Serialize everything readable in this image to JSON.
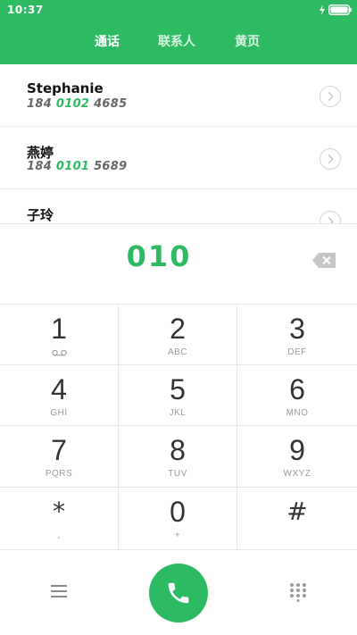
{
  "status": {
    "time": "10:37"
  },
  "tabs": [
    {
      "label": "通话"
    },
    {
      "label": "联系人"
    },
    {
      "label": "黄页"
    }
  ],
  "results": [
    {
      "name": "Stephanie",
      "number_pre": "184 ",
      "number_match": "0102",
      "number_post": " 4685"
    },
    {
      "name": "燕婷",
      "number_pre": "184 ",
      "number_match": "0101",
      "number_post": " 5689"
    },
    {
      "name": "子玲",
      "number_pre": "",
      "number_match": "",
      "number_post": ""
    }
  ],
  "dial": {
    "entered": "010"
  },
  "keypad": [
    {
      "digit": "1",
      "letters": ""
    },
    {
      "digit": "2",
      "letters": "ABC"
    },
    {
      "digit": "3",
      "letters": "DEF"
    },
    {
      "digit": "4",
      "letters": "GHI"
    },
    {
      "digit": "5",
      "letters": "JKL"
    },
    {
      "digit": "6",
      "letters": "MNO"
    },
    {
      "digit": "7",
      "letters": "PQRS"
    },
    {
      "digit": "8",
      "letters": "TUV"
    },
    {
      "digit": "9",
      "letters": "WXYZ"
    },
    {
      "digit": "*",
      "letters": ","
    },
    {
      "digit": "0",
      "letters": "+"
    },
    {
      "digit": "#",
      "letters": ""
    }
  ],
  "colors": {
    "accent": "#2dba62"
  },
  "icons": [
    "charging-icon",
    "battery-icon",
    "chevron-right-icon",
    "backspace-icon",
    "voicemail-icon",
    "menu-icon",
    "phone-icon",
    "dialpad-icon"
  ]
}
